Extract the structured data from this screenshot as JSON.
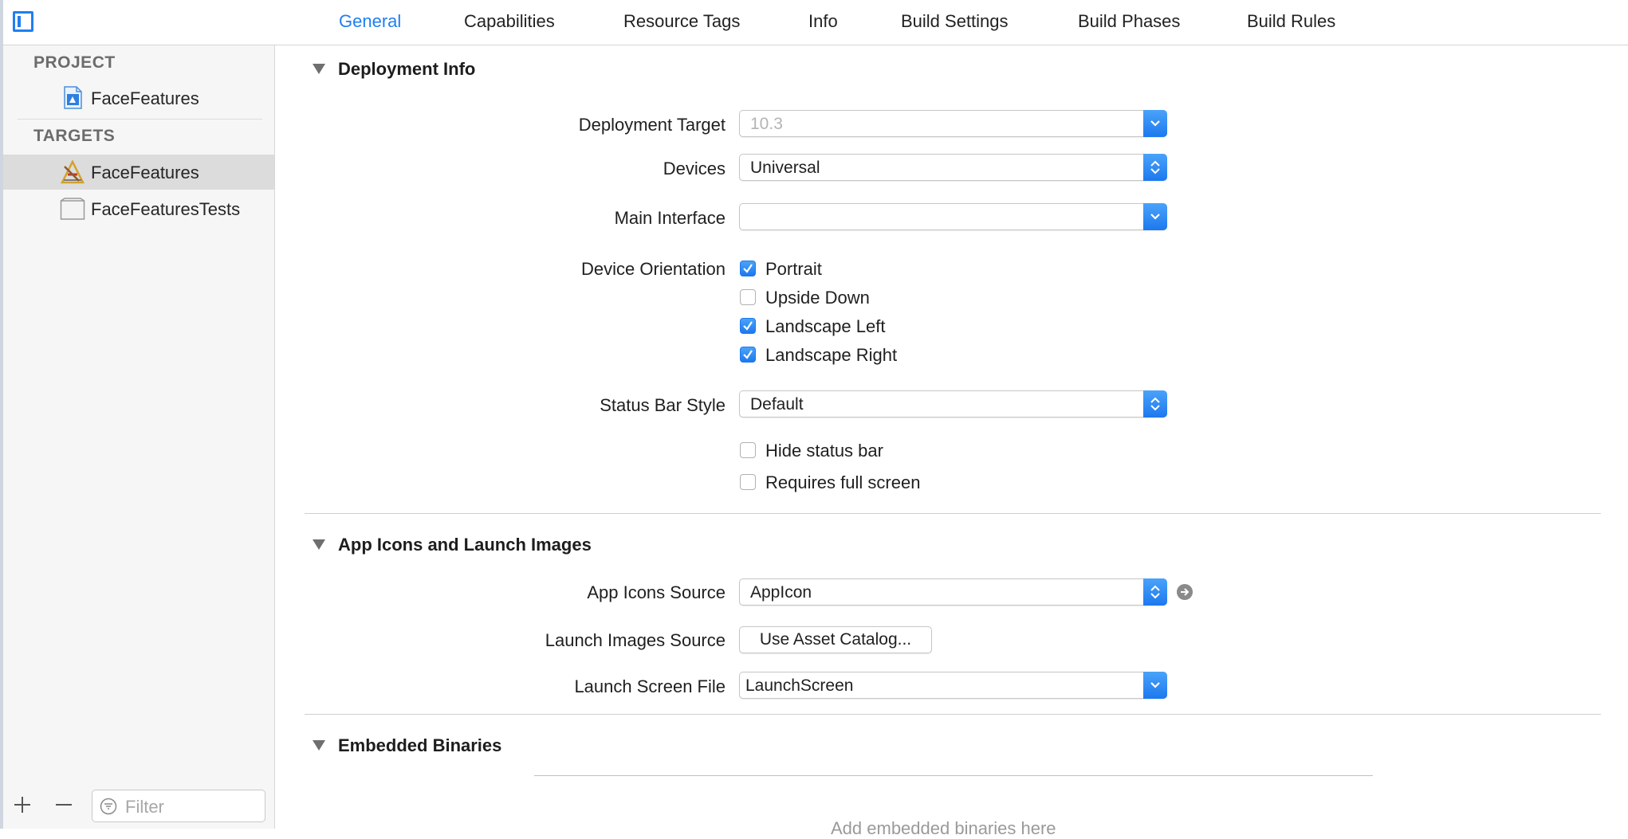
{
  "tabs": [
    {
      "label": "General",
      "active": true
    },
    {
      "label": "Capabilities"
    },
    {
      "label": "Resource Tags"
    },
    {
      "label": "Info"
    },
    {
      "label": "Build Settings"
    },
    {
      "label": "Build Phases"
    },
    {
      "label": "Build Rules"
    }
  ],
  "sidebar": {
    "project_header": "PROJECT",
    "project_item": "FaceFeatures",
    "targets_header": "TARGETS",
    "targets": [
      {
        "label": "FaceFeatures",
        "selected": true
      },
      {
        "label": "FaceFeaturesTests"
      }
    ],
    "filter_placeholder": "Filter"
  },
  "deployment": {
    "title": "Deployment Info",
    "target_label": "Deployment Target",
    "target_value": "10.3",
    "devices_label": "Devices",
    "devices_value": "Universal",
    "main_interface_label": "Main Interface",
    "main_interface_value": "",
    "orientation_label": "Device Orientation",
    "orientations": [
      {
        "label": "Portrait",
        "checked": true
      },
      {
        "label": "Upside Down",
        "checked": false
      },
      {
        "label": "Landscape Left",
        "checked": true
      },
      {
        "label": "Landscape Right",
        "checked": true
      }
    ],
    "status_bar_label": "Status Bar Style",
    "status_bar_value": "Default",
    "hide_status_bar": {
      "label": "Hide status bar",
      "checked": false
    },
    "requires_full_screen": {
      "label": "Requires full screen",
      "checked": false
    }
  },
  "app_icons": {
    "title": "App Icons and Launch Images",
    "icons_source_label": "App Icons Source",
    "icons_source_value": "AppIcon",
    "launch_images_label": "Launch Images Source",
    "launch_images_button": "Use Asset Catalog...",
    "launch_screen_label": "Launch Screen File",
    "launch_screen_value": "LaunchScreen"
  },
  "embedded": {
    "title": "Embedded Binaries",
    "placeholder": "Add embedded binaries here"
  },
  "colors": {
    "accent": "#1f7ff2"
  }
}
